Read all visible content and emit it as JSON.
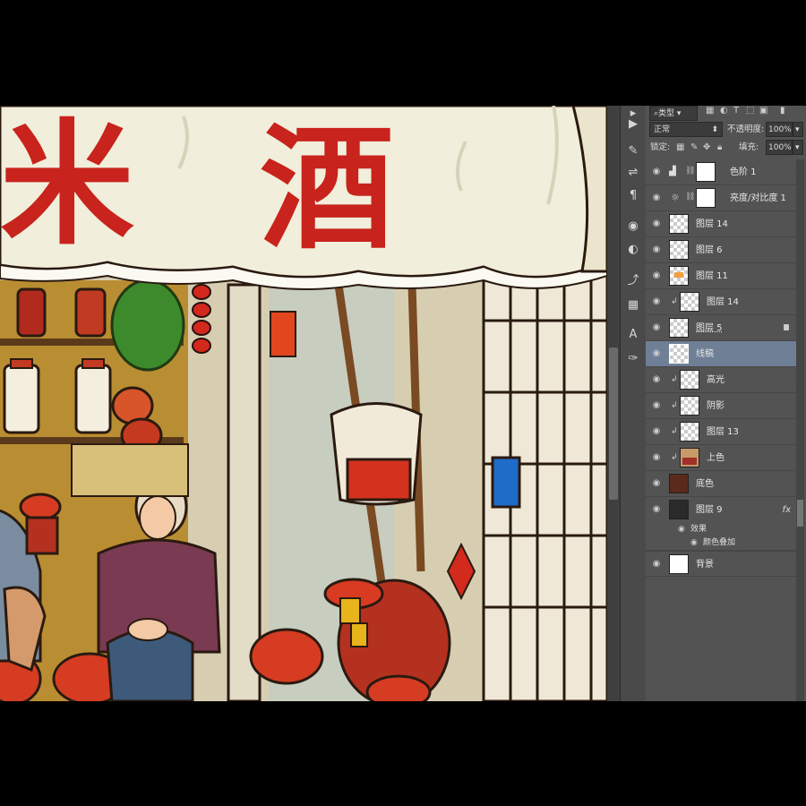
{
  "app": "Photoshop",
  "panel": {
    "filter_kind": "类型",
    "blend_mode": "正常",
    "opacity_label": "不透明度:",
    "opacity_value": "100%",
    "lock_label": "锁定:",
    "fill_label": "填充:",
    "fill_value": "100%"
  },
  "layers": [
    {
      "name": "色阶 1",
      "type": "adjustment",
      "icon": "levels-icon",
      "visible": true,
      "selected": false,
      "clipped": false
    },
    {
      "name": "亮度/对比度 1",
      "type": "adjustment",
      "icon": "brightness-icon",
      "visible": true,
      "selected": false,
      "clipped": false
    },
    {
      "name": "图层 14",
      "type": "pixel",
      "visible": true,
      "selected": false,
      "clipped": false
    },
    {
      "name": "图层 6",
      "type": "pixel",
      "visible": true,
      "selected": false,
      "clipped": false
    },
    {
      "name": "图层 11",
      "type": "pixel",
      "visible": true,
      "selected": false,
      "clipped": false
    },
    {
      "name": "图层 14",
      "type": "pixel",
      "visible": true,
      "selected": false,
      "clipped": true
    },
    {
      "name": "图层 5",
      "type": "pixel",
      "visible": true,
      "selected": false,
      "clipped": false,
      "locked": true
    },
    {
      "name": "线稿",
      "type": "pixel",
      "visible": true,
      "selected": true,
      "clipped": false
    },
    {
      "name": "高光",
      "type": "pixel",
      "visible": true,
      "selected": false,
      "clipped": true
    },
    {
      "name": "阴影",
      "type": "pixel",
      "visible": true,
      "selected": false,
      "clipped": true
    },
    {
      "name": "图层 13",
      "type": "pixel",
      "visible": true,
      "selected": false,
      "clipped": true
    },
    {
      "name": "上色",
      "type": "pixel",
      "visible": true,
      "selected": false,
      "clipped": true
    },
    {
      "name": "底色",
      "type": "pixel",
      "visible": true,
      "selected": false,
      "clipped": false
    },
    {
      "name": "图层 9",
      "type": "pixel",
      "visible": true,
      "selected": false,
      "clipped": false,
      "fx": "fx"
    },
    {
      "name": "背景",
      "type": "pixel",
      "visible": true,
      "selected": false,
      "clipped": false
    }
  ],
  "effects": {
    "label": "效果",
    "items": [
      "颜色叠加"
    ]
  },
  "canvas": {
    "sign_text": [
      "米",
      "酒"
    ]
  },
  "colors": {
    "ui_bg": "#535353",
    "selected": "#6f7f96",
    "sign_red": "#c8231c",
    "cloth": "#f1eedb"
  }
}
